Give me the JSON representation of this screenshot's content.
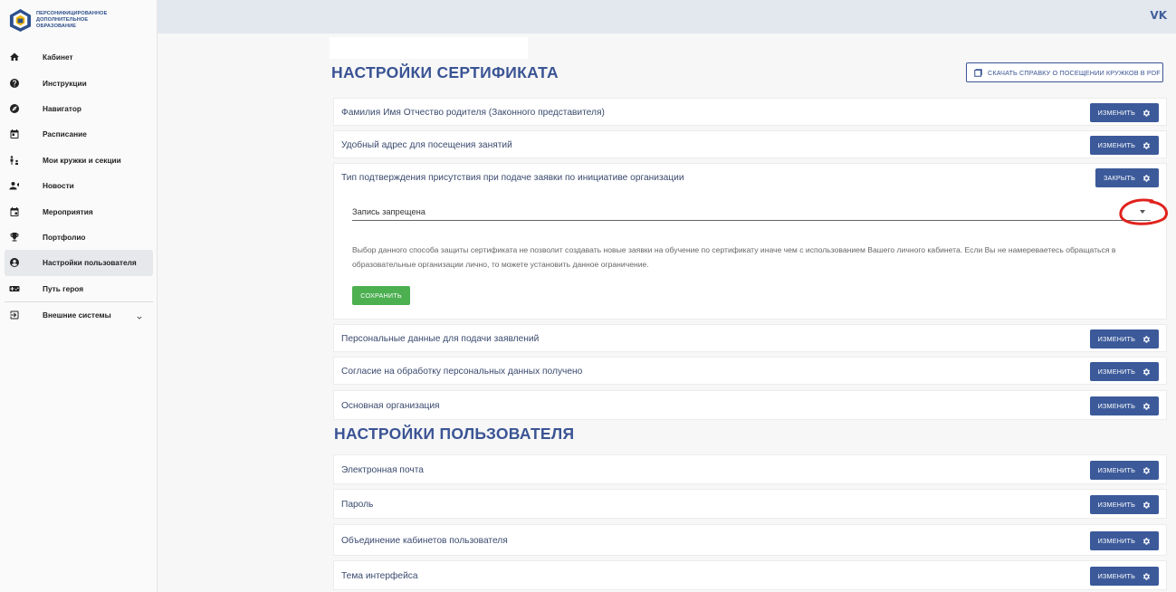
{
  "brand": {
    "logo_lines": [
      "ПЕРСОНИФИЦИРОВАННОЕ",
      "ДОПОЛНИТЕЛЬНОЕ",
      "ОБРАЗОВАНИЕ"
    ]
  },
  "topbar": {
    "vk_label": "VK"
  },
  "sidebar": {
    "items": [
      {
        "label": "Кабинет",
        "icon": "home-icon"
      },
      {
        "label": "Инструкции",
        "icon": "help-icon"
      },
      {
        "label": "Навигатор",
        "icon": "compass-icon"
      },
      {
        "label": "Расписание",
        "icon": "calendar-icon"
      },
      {
        "label": "Мои кружки и секции",
        "icon": "kids-icon"
      },
      {
        "label": "Новости",
        "icon": "megaphone-icon"
      },
      {
        "label": "Мероприятия",
        "icon": "event-icon"
      },
      {
        "label": "Портфолио",
        "icon": "trophy-icon"
      },
      {
        "label": "Настройки пользователя",
        "icon": "user-circle-icon",
        "active": true
      },
      {
        "label": "Путь героя",
        "icon": "gamepad-icon"
      }
    ],
    "external": {
      "label": "Внешние системы",
      "icon": "login-icon"
    }
  },
  "main": {
    "certificate_title": "НАСТРОЙКИ СЕРТИФИКАТА",
    "user_title": "НАСТРОЙКИ ПОЛЬЗОВАТЕЛЯ",
    "pdf_button": "СКАЧАТЬ СПРАВКУ О ПОСЕЩЕНИИ КРУЖКОВ В PDF",
    "cert_rows": [
      {
        "title": "Фамилия Имя Отчество родителя (Законного представителя)",
        "button": "ИЗМЕНИТЬ"
      },
      {
        "title": "Удобный адрес для посещения занятий",
        "button": "ИЗМЕНИТЬ"
      }
    ],
    "expanded": {
      "title": "Тип подтверждения присутствия при подаче заявки по инициативе организации",
      "button": "ЗАКРЫТЬ",
      "select_value": "Запись запрещена",
      "help_text": "Выбор данного способа защиты сертификата не позволит создавать новые заявки на обучение по сертификату иначе чем с использованием Вашего личного кабинета. Если Вы не намереваетесь обращаться в образовательные организации лично, то можете установить данное ограничение.",
      "save_button": "СОХРАНИТЬ"
    },
    "cert_rows_after": [
      {
        "title": "Персональные данные для подачи заявлений",
        "button": "ИЗМЕНИТЬ"
      },
      {
        "title": "Согласие на обработку персональных данных получено",
        "button": "ИЗМЕНИТЬ"
      },
      {
        "title": "Основная организация",
        "button": "ИЗМЕНИТЬ"
      }
    ],
    "user_rows": [
      {
        "title": "Электронная почта",
        "button": "ИЗМЕНИТЬ"
      },
      {
        "title": "Пароль",
        "button": "ИЗМЕНИТЬ"
      },
      {
        "title": "Объединение кабинетов пользователя",
        "button": "ИЗМЕНИТЬ"
      },
      {
        "title": "Тема интерфейса",
        "button": "ИЗМЕНИТЬ"
      }
    ]
  },
  "colors": {
    "primary": "#3c5a9a",
    "heading": "#3a5494",
    "save": "#4caf50",
    "annotation": "#e0231e"
  }
}
